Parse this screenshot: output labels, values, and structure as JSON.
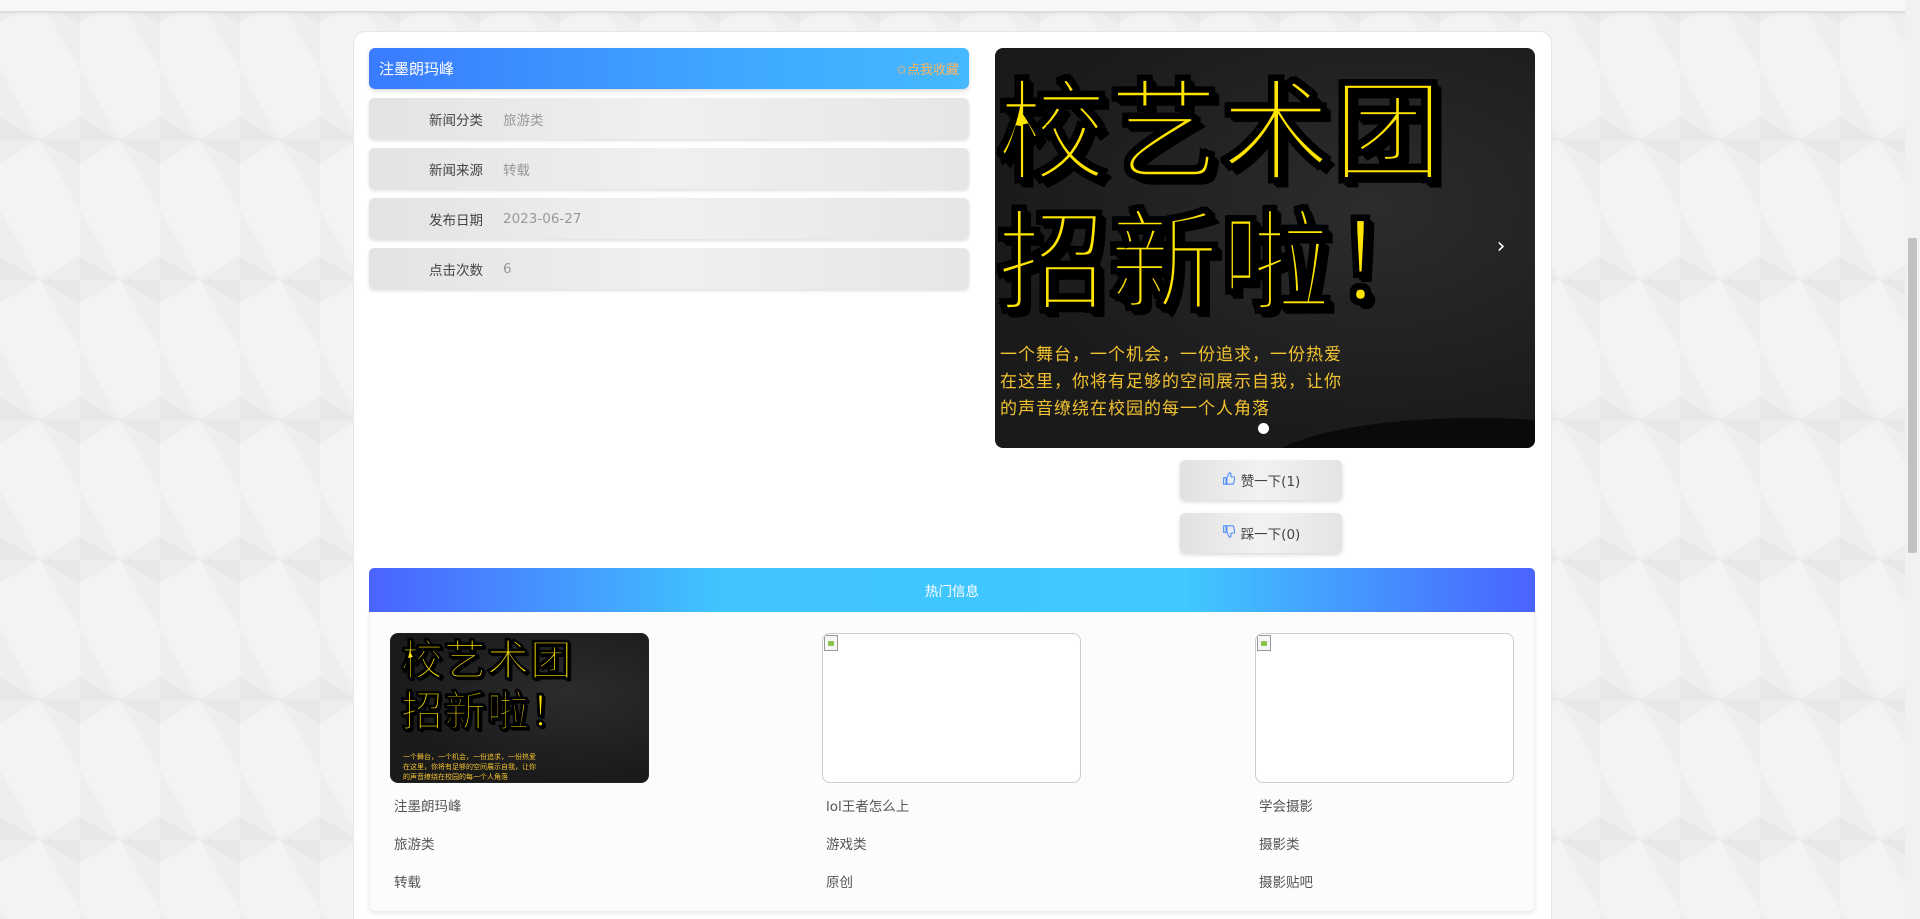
{
  "detail": {
    "title": "注墨朗玛峰",
    "favorite_label": "✩点我收藏",
    "fields": [
      {
        "label": "新闻分类",
        "value": "旅游类"
      },
      {
        "label": "新闻来源",
        "value": "转载"
      },
      {
        "label": "发布日期",
        "value": "2023-06-27"
      },
      {
        "label": "点击次数",
        "value": "6"
      }
    ]
  },
  "carousel": {
    "headline_line1": "校艺术团",
    "headline_line2": "招新啦！",
    "sub_line1": "一个舞台，一个机会，一份追求，一份热爱",
    "sub_line2": "在这里，你将有足够的空间展示自我，让你",
    "sub_line3": "的声音缭绕在校园的每一个人角落",
    "next_icon": "chevron-right-icon",
    "next_glyph": "›",
    "slide_count": 1,
    "active_slide": 1
  },
  "votes": {
    "like_label": "赞一下(1)",
    "dislike_label": "踩一下(0)",
    "like_icon": "thumbs-up-icon",
    "dislike_icon": "thumbs-down-icon"
  },
  "hot": {
    "header": "热门信息",
    "items": [
      {
        "title": "注墨朗玛峰",
        "category": "旅游类",
        "source": "转载",
        "has_image": true
      },
      {
        "title": "lol王者怎么上",
        "category": "游戏类",
        "source": "原创",
        "has_image": false
      },
      {
        "title": "学会摄影",
        "category": "摄影类",
        "source": "摄影贴吧",
        "has_image": false
      }
    ]
  },
  "colors": {
    "title_gradient_start": "#3a7bff",
    "title_gradient_end": "#45b8ff",
    "favorite_text": "#ffb35c",
    "hot_header_start": "#4a63ff",
    "hot_header_mid": "#40c4ff",
    "poster_yellow": "#ffe400"
  }
}
